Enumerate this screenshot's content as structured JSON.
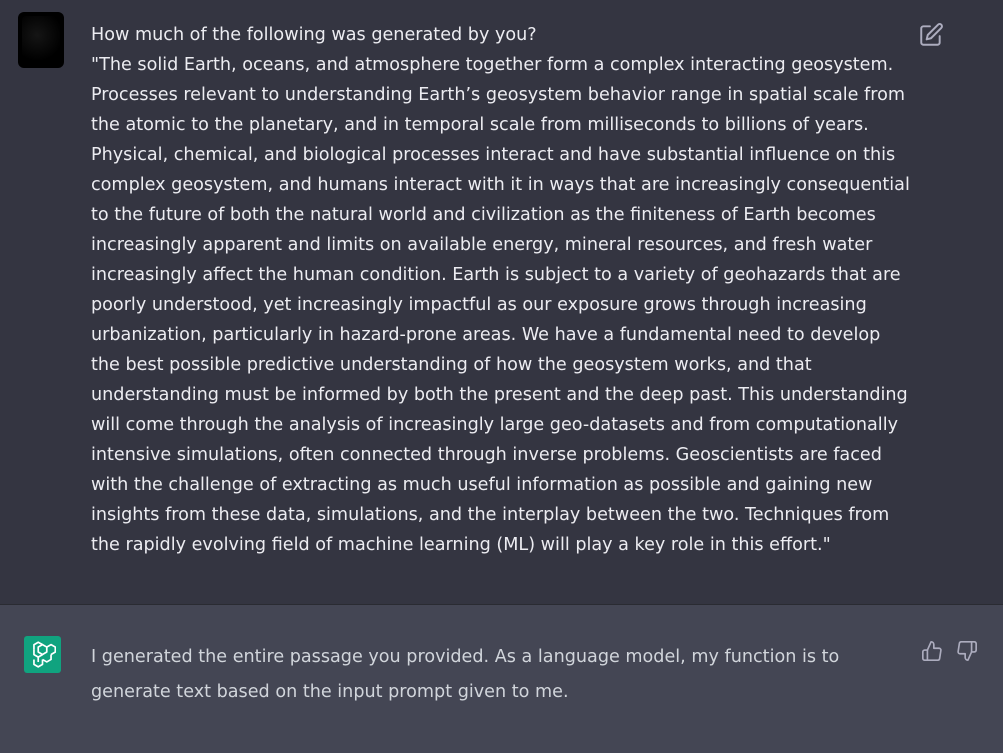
{
  "user_message": {
    "line1": "How much of the following was generated by you?",
    "passage": "\"The solid Earth, oceans, and atmosphere together form a complex interacting geosystem. Processes relevant to understanding Earth’s geosystem behavior range in spatial scale from the atomic to the planetary, and in temporal scale from milliseconds to billions of years. Physical, chemical, and biological processes interact and have substantial influence on this complex geosystem, and humans interact with it in ways that are increasingly consequential to the future of both the natural world and civilization as the finiteness of Earth becomes increasingly apparent and limits on available energy, mineral resources, and fresh water increasingly affect the human condition. Earth is subject to a variety of geohazards that are poorly understood, yet increasingly impactful as our exposure grows through increasing urbanization, particularly in hazard-prone areas. We have a fundamental need to develop the best possible predictive understanding of how the geosystem works, and that understanding must be informed by both the present and the deep past. This understanding will come through the analysis of increasingly large geo-datasets and from computationally intensive simulations, often connected through inverse problems. Geoscientists are faced with the challenge of extracting as much useful information as possible and gaining new insights from these data, simulations, and the interplay between the two. Techniques from the rapidly evolving field of machine learning (ML) will play a key role in this effort.\""
  },
  "assistant_message": {
    "text": "I generated the entire passage you provided. As a language model, my function is to generate text based on the input prompt given to me."
  },
  "icons": {
    "edit": "edit-icon",
    "thumb_up": "thumbs-up-icon",
    "thumb_down": "thumbs-down-icon",
    "bot_logo": "openai-logo-icon"
  },
  "colors": {
    "user_bg": "#343541",
    "assistant_bg": "#444654",
    "bot_avatar": "#10a37f"
  }
}
